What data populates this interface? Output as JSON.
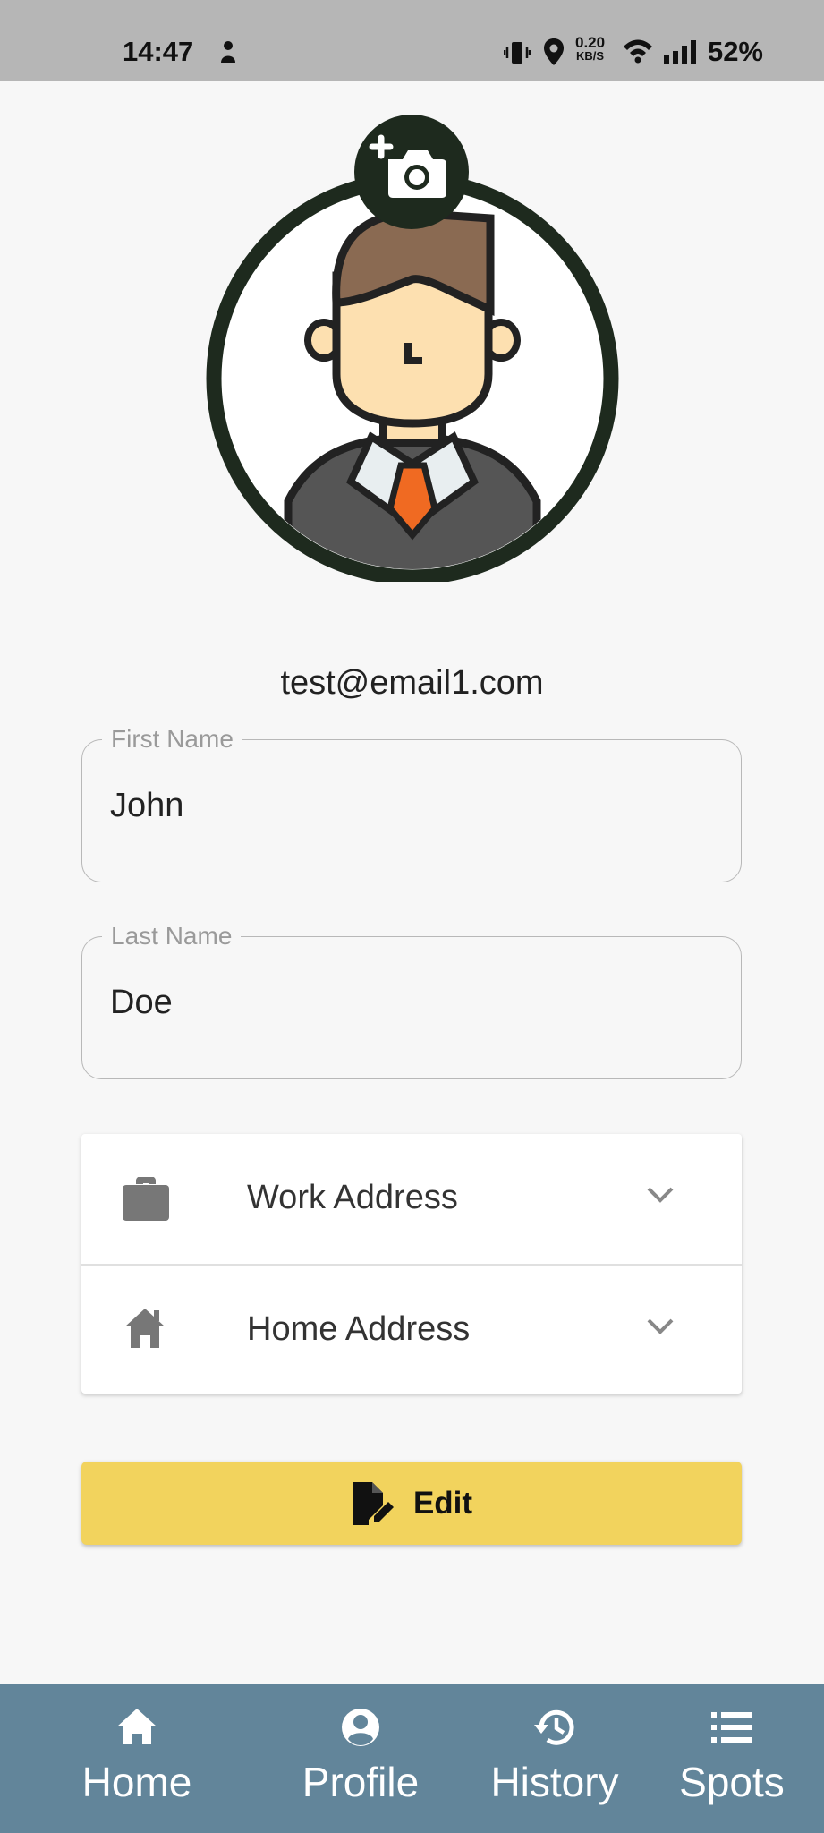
{
  "status_bar": {
    "time": "14:47",
    "speed_value": "0.20",
    "speed_unit": "KB/S",
    "battery": "52%"
  },
  "profile": {
    "email": "test@email1.com",
    "first_name": {
      "label": "First Name",
      "value": "John"
    },
    "last_name": {
      "label": "Last Name",
      "value": "Doe"
    }
  },
  "addresses": [
    {
      "label": "Work Address",
      "icon": "briefcase-icon"
    },
    {
      "label": "Home Address",
      "icon": "home-icon"
    }
  ],
  "edit_button": {
    "label": "Edit",
    "icon": "edit-document-icon"
  },
  "bottom_nav": [
    {
      "label": "Home",
      "icon": "home-icon"
    },
    {
      "label": "Profile",
      "icon": "account-icon"
    },
    {
      "label": "History",
      "icon": "history-icon"
    },
    {
      "label": "Spots",
      "icon": "list-icon"
    }
  ],
  "colors": {
    "status_bar": "#b6b6b6",
    "background": "#f7f7f7",
    "accent_button": "#f2d35d",
    "bottom_nav": "#62859a",
    "avatar_ring": "#1e2a1e",
    "tie": "#f06a22"
  }
}
